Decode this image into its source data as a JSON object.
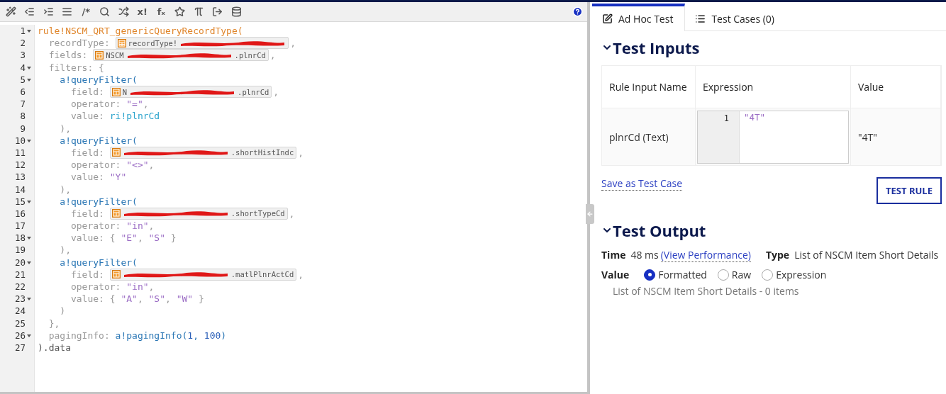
{
  "toolbar": [
    {
      "kind": "icon"
    },
    {
      "kind": "icon"
    },
    {
      "kind": "icon"
    },
    {
      "kind": "icon"
    },
    {
      "kind": "glyph",
      "text": "/*"
    },
    {
      "kind": "icon"
    },
    {
      "kind": "icon"
    },
    {
      "kind": "glyph",
      "text": "x!"
    },
    {
      "kind": "glyph",
      "text": "fₓ"
    },
    {
      "kind": "icon"
    },
    {
      "kind": "icon"
    },
    {
      "kind": "icon"
    },
    {
      "kind": "icon"
    }
  ],
  "editor": {
    "lines": [
      {
        "number": "1",
        "fold": true,
        "tokens": [
          {
            "kind": "rule",
            "text": "rule!NSCM_QRT_genericQueryRecordType("
          }
        ]
      },
      {
        "number": "2",
        "fold": false,
        "tokens": [
          {
            "kind": "key",
            "text": "  recordType: "
          },
          {
            "kind": "chip",
            "prefix": "recordType!"
          },
          {
            "kind": "key",
            "text": ","
          }
        ]
      },
      {
        "number": "3",
        "fold": false,
        "tokens": [
          {
            "kind": "key",
            "text": "  fields: "
          },
          {
            "kind": "chip",
            "prefix": "NSCM",
            "suffix": ".plnrCd"
          },
          {
            "kind": "key",
            "text": ","
          }
        ]
      },
      {
        "number": "4",
        "fold": true,
        "tokens": [
          {
            "kind": "key",
            "text": "  filters: {"
          }
        ]
      },
      {
        "number": "5",
        "fold": true,
        "tokens": [
          {
            "kind": "func",
            "text": "    a!queryFilter("
          }
        ]
      },
      {
        "number": "6",
        "fold": false,
        "tokens": [
          {
            "kind": "key",
            "text": "      field: "
          },
          {
            "kind": "chip",
            "prefix": "N",
            "suffix": ".plnrCd"
          },
          {
            "kind": "key",
            "text": ","
          }
        ]
      },
      {
        "number": "7",
        "fold": false,
        "tokens": [
          {
            "kind": "key",
            "text": "      operator: "
          },
          {
            "kind": "string",
            "text": "\"=\""
          },
          {
            "kind": "key",
            "text": ","
          }
        ]
      },
      {
        "number": "8",
        "fold": false,
        "tokens": [
          {
            "kind": "key",
            "text": "      value: "
          },
          {
            "kind": "ref",
            "text": "ri!plnrCd"
          }
        ]
      },
      {
        "number": "9",
        "fold": false,
        "tokens": [
          {
            "kind": "key",
            "text": "    ),"
          }
        ]
      },
      {
        "number": "10",
        "fold": true,
        "tokens": [
          {
            "kind": "func",
            "text": "    a!queryFilter("
          }
        ]
      },
      {
        "number": "11",
        "fold": false,
        "tokens": [
          {
            "kind": "key",
            "text": "      field: "
          },
          {
            "kind": "chip",
            "suffix": ".shortHistIndc"
          },
          {
            "kind": "key",
            "text": ","
          }
        ]
      },
      {
        "number": "12",
        "fold": false,
        "tokens": [
          {
            "kind": "key",
            "text": "      operator: "
          },
          {
            "kind": "string",
            "text": "\"<>\""
          },
          {
            "kind": "key",
            "text": ","
          }
        ]
      },
      {
        "number": "13",
        "fold": false,
        "tokens": [
          {
            "kind": "key",
            "text": "      value: "
          },
          {
            "kind": "string",
            "text": "\"Y\""
          }
        ]
      },
      {
        "number": "14",
        "fold": false,
        "tokens": [
          {
            "kind": "key",
            "text": "    ),"
          }
        ]
      },
      {
        "number": "15",
        "fold": true,
        "tokens": [
          {
            "kind": "func",
            "text": "    a!queryFilter("
          }
        ]
      },
      {
        "number": "16",
        "fold": false,
        "tokens": [
          {
            "kind": "key",
            "text": "      field: "
          },
          {
            "kind": "chip",
            "suffix": ".shortTypeCd"
          },
          {
            "kind": "key",
            "text": ","
          }
        ]
      },
      {
        "number": "17",
        "fold": false,
        "tokens": [
          {
            "kind": "key",
            "text": "      operator: "
          },
          {
            "kind": "string",
            "text": "\"in\""
          },
          {
            "kind": "key",
            "text": ","
          }
        ]
      },
      {
        "number": "18",
        "fold": true,
        "tokens": [
          {
            "kind": "key",
            "text": "      value: { "
          },
          {
            "kind": "string",
            "text": "\"E\""
          },
          {
            "kind": "key",
            "text": ", "
          },
          {
            "kind": "string",
            "text": "\"S\""
          },
          {
            "kind": "key",
            "text": " }"
          }
        ]
      },
      {
        "number": "19",
        "fold": false,
        "tokens": [
          {
            "kind": "key",
            "text": "    ),"
          }
        ]
      },
      {
        "number": "20",
        "fold": true,
        "tokens": [
          {
            "kind": "func",
            "text": "    a!queryFilter("
          }
        ]
      },
      {
        "number": "21",
        "fold": false,
        "tokens": [
          {
            "kind": "key",
            "text": "      field: "
          },
          {
            "kind": "chip",
            "suffix": ".matlPlnrActCd"
          },
          {
            "kind": "key",
            "text": ","
          }
        ]
      },
      {
        "number": "22",
        "fold": false,
        "tokens": [
          {
            "kind": "key",
            "text": "      operator: "
          },
          {
            "kind": "string",
            "text": "\"in\""
          },
          {
            "kind": "key",
            "text": ","
          }
        ]
      },
      {
        "number": "23",
        "fold": true,
        "tokens": [
          {
            "kind": "key",
            "text": "      value: { "
          },
          {
            "kind": "string",
            "text": "\"A\""
          },
          {
            "kind": "key",
            "text": ", "
          },
          {
            "kind": "string",
            "text": "\"S\""
          },
          {
            "kind": "key",
            "text": ", "
          },
          {
            "kind": "string",
            "text": "\"W\""
          },
          {
            "kind": "key",
            "text": " }"
          }
        ]
      },
      {
        "number": "24",
        "fold": false,
        "tokens": [
          {
            "kind": "key",
            "text": "    )"
          }
        ]
      },
      {
        "number": "25",
        "fold": false,
        "tokens": [
          {
            "kind": "key",
            "text": "  },"
          }
        ]
      },
      {
        "number": "26",
        "fold": true,
        "tokens": [
          {
            "kind": "key",
            "text": "  pagingInfo: "
          },
          {
            "kind": "func",
            "text": "a!pagingInfo("
          },
          {
            "kind": "number",
            "text": "1"
          },
          {
            "kind": "func",
            "text": ", "
          },
          {
            "kind": "number",
            "text": "100"
          },
          {
            "kind": "func",
            "text": ")"
          }
        ]
      },
      {
        "number": "27",
        "fold": false,
        "tokens": [
          {
            "kind": "plain",
            "text": ").data"
          }
        ]
      }
    ]
  },
  "tabs": [
    {
      "label": "Ad Hoc Test",
      "selected": true
    },
    {
      "label": "Test Cases (0)",
      "selected": false
    }
  ],
  "test_inputs": {
    "title": "Test Inputs",
    "expanded": true,
    "columns": [
      "Rule Input Name",
      "Expression",
      "Value"
    ],
    "rows": [
      {
        "name": "plnrCd (Text)",
        "line_number": "1",
        "expression": "\"4T\"",
        "value": "\"4T\""
      }
    ],
    "save_link": "Save as Test Case",
    "button": "TEST RULE"
  },
  "test_output": {
    "title": "Test Output",
    "expanded": true,
    "time_label": "Time",
    "time": "48 ms",
    "performance_link": "(View Performance)",
    "type_label": "Type",
    "type": "List of NSCM Item Short Details",
    "value_label": "Value",
    "options": [
      {
        "label": "Formatted",
        "selected": true
      },
      {
        "label": "Raw",
        "selected": false
      },
      {
        "label": "Expression",
        "selected": false
      }
    ],
    "result": "List of NSCM Item Short Details - 0 items"
  }
}
